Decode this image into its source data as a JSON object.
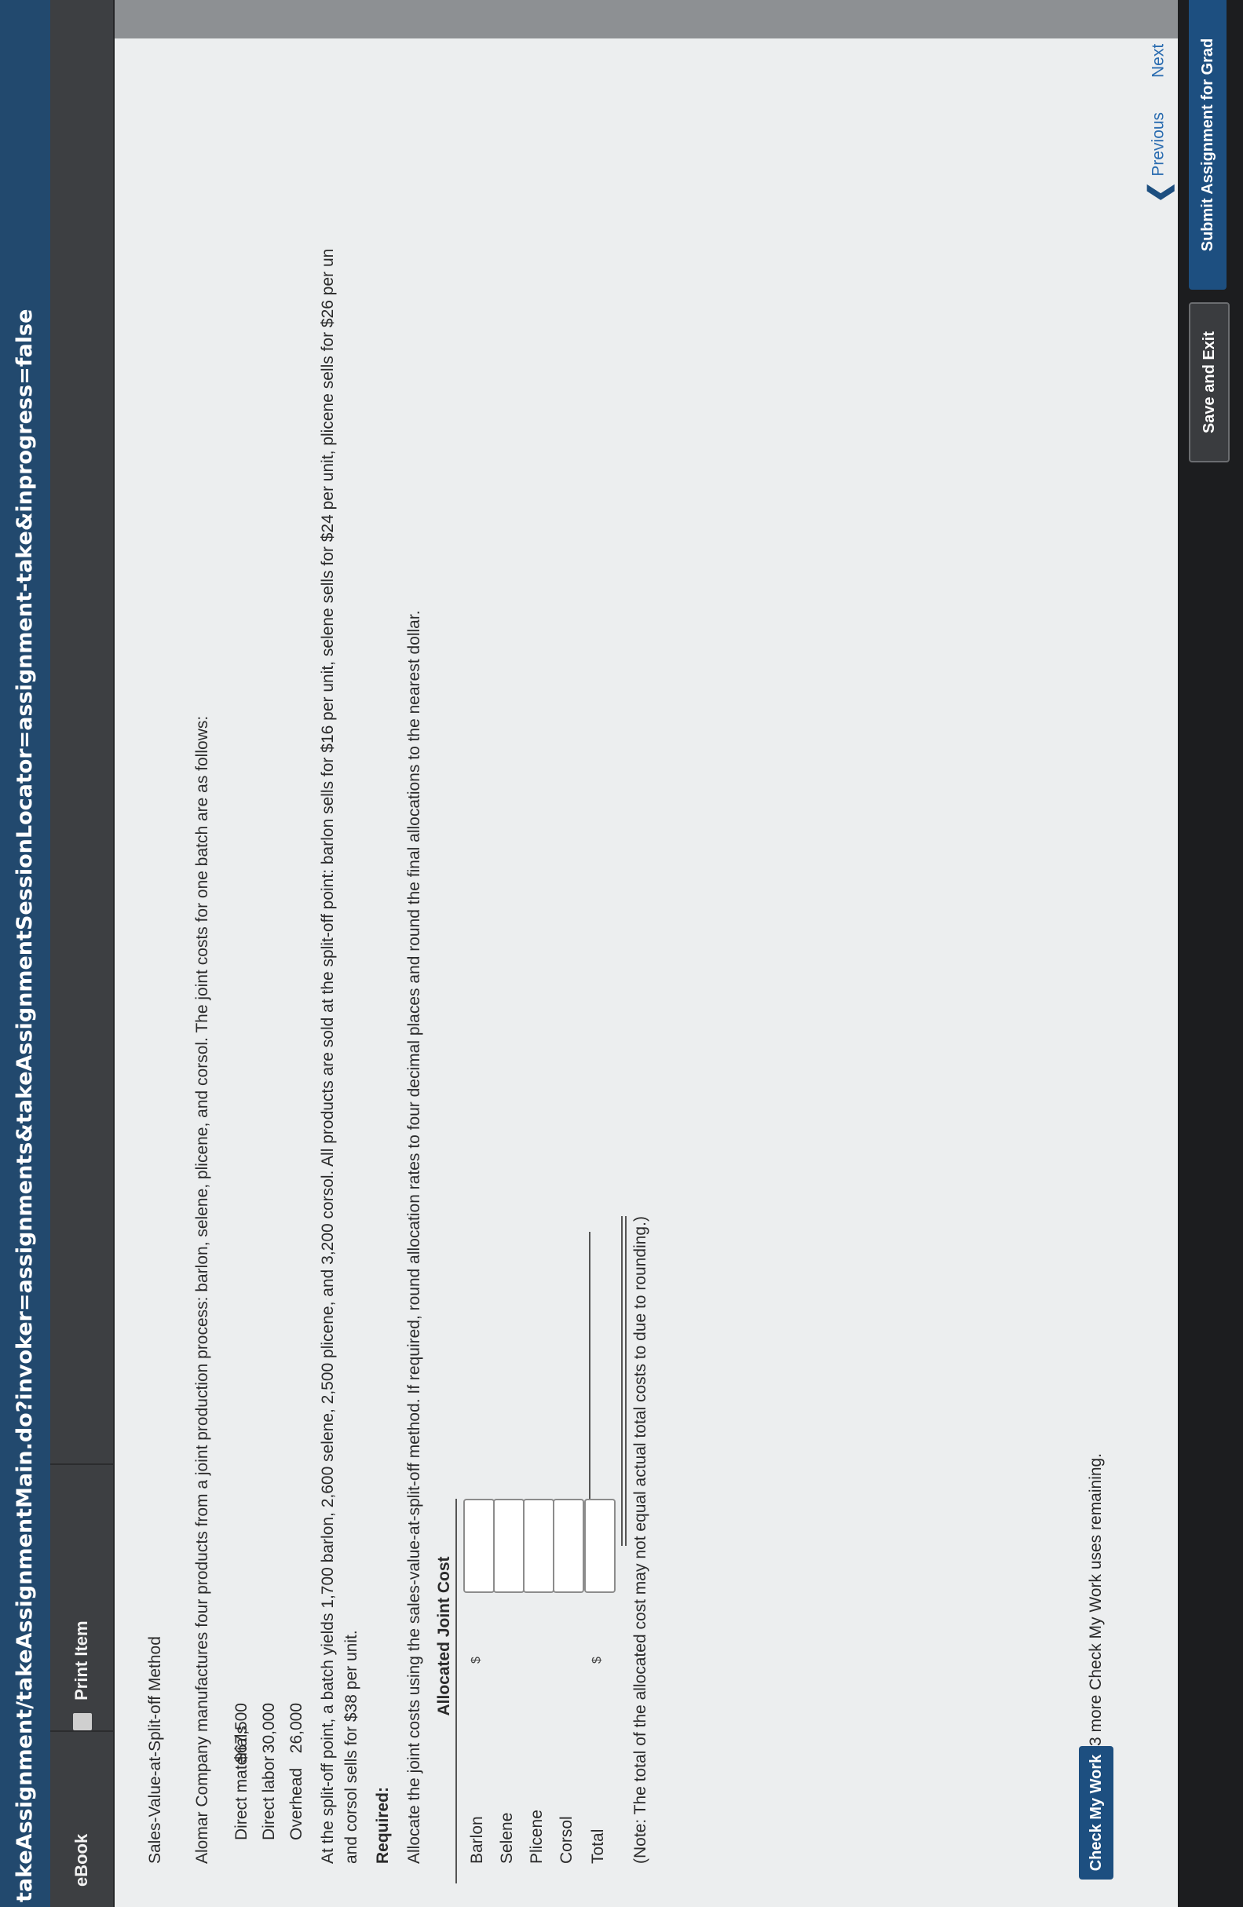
{
  "browser": {
    "url": "takeAssignment/takeAssignmentMain.do?invoker=assignments&takeAssignmentSessionLocator=assignment-take&inprogress=false"
  },
  "tabs": {
    "ebook": "eBook",
    "print": "Print Item"
  },
  "problem": {
    "title": "Sales-Value-at-Split-off Method",
    "intro": "Alomar Company manufactures four products from a joint production process: barlon, selene, plicene, and corsol. The joint costs for one batch are as follows:",
    "costs": [
      {
        "label": "Direct materials",
        "value": "$67,500"
      },
      {
        "label": "Direct labor",
        "value": "30,000"
      },
      {
        "label": "Overhead",
        "value": "26,000"
      }
    ],
    "split_line1": "At the split-off point, a batch yields 1,700 barlon, 2,600 selene, 2,500 plicene, and 3,200 corsol. All products are sold at the split-off point: barlon sells for $16 per unit, selene sells for $24 per unit, plicene sells for $26 per un",
    "split_line2": "and corsol sells for $38 per unit.",
    "required_heading": "Required:",
    "required_text": "Allocate the joint costs using the sales-value-at-split-off method. If required, round allocation rates to four decimal places and round the final allocations to the nearest dollar.",
    "table": {
      "column_header": "Allocated Joint Cost",
      "rows": [
        {
          "label": "Barlon",
          "prefix": "$",
          "value": ""
        },
        {
          "label": "Selene",
          "prefix": "",
          "value": ""
        },
        {
          "label": "Plicene",
          "prefix": "",
          "value": ""
        },
        {
          "label": "Corsol",
          "prefix": "",
          "value": ""
        },
        {
          "label": "Total",
          "prefix": "$",
          "value": ""
        }
      ]
    },
    "note": "(Note: The total of the allocated cost may not equal actual total costs to due to rounding.)"
  },
  "check": {
    "button": "Check My Work",
    "remaining": "3 more Check My Work uses remaining."
  },
  "navigation": {
    "previous": "Previous",
    "next": "Next"
  },
  "footer": {
    "save_exit": "Save and Exit",
    "submit": "Submit Assignment for Grad"
  },
  "icons": [
    "print-icon",
    "chevron-down-icon",
    "chevron-left-icon",
    "chevron-right-icon"
  ],
  "colors": {
    "url_bar": "#22496e",
    "tab_bar": "#3d3f42",
    "primary_button": "#1d4f80",
    "link": "#2a6cb0"
  }
}
